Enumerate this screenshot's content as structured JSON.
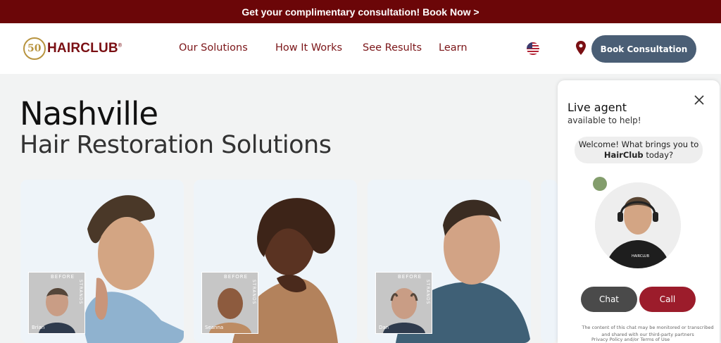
{
  "promo": {
    "text": "Get your complimentary consultation! Book Now >"
  },
  "header": {
    "logo_badge": "50",
    "logo_text": "HAIRCLUB",
    "nav": [
      "Our Solutions",
      "How It Works",
      "See Results",
      "Learn"
    ],
    "book_button": "Book Consultation"
  },
  "hero": {
    "title": "Nashville",
    "subtitle": "Hair Restoration Solutions"
  },
  "cards": [
    {
      "before_label": "BEFORE",
      "strands_label": "STRANDS",
      "name": "Brian"
    },
    {
      "before_label": "BEFORE",
      "strands_label": "STRANDS",
      "name": "Seanna"
    },
    {
      "before_label": "BEFORE",
      "strands_label": "STRANDS",
      "name": "Dan"
    }
  ],
  "chat": {
    "title": "Live agent",
    "subtitle": "available to help!",
    "bubble_line1": "Welcome! What brings you to",
    "bubble_brand": "HairClub",
    "bubble_line2_end": " today?",
    "chat_button": "Chat",
    "call_button": "Call",
    "disclaimer": "The content of this chat may be monitored or transcribed and shared with our third-party partners",
    "privacy": "Privacy Policy and/or Terms of Use"
  },
  "colors": {
    "brand_red": "#7a0f13",
    "promo_bg": "#6b0608",
    "book_btn": "#4a5e75",
    "call_btn": "#9c1c2b",
    "gold": "#b8943f"
  }
}
